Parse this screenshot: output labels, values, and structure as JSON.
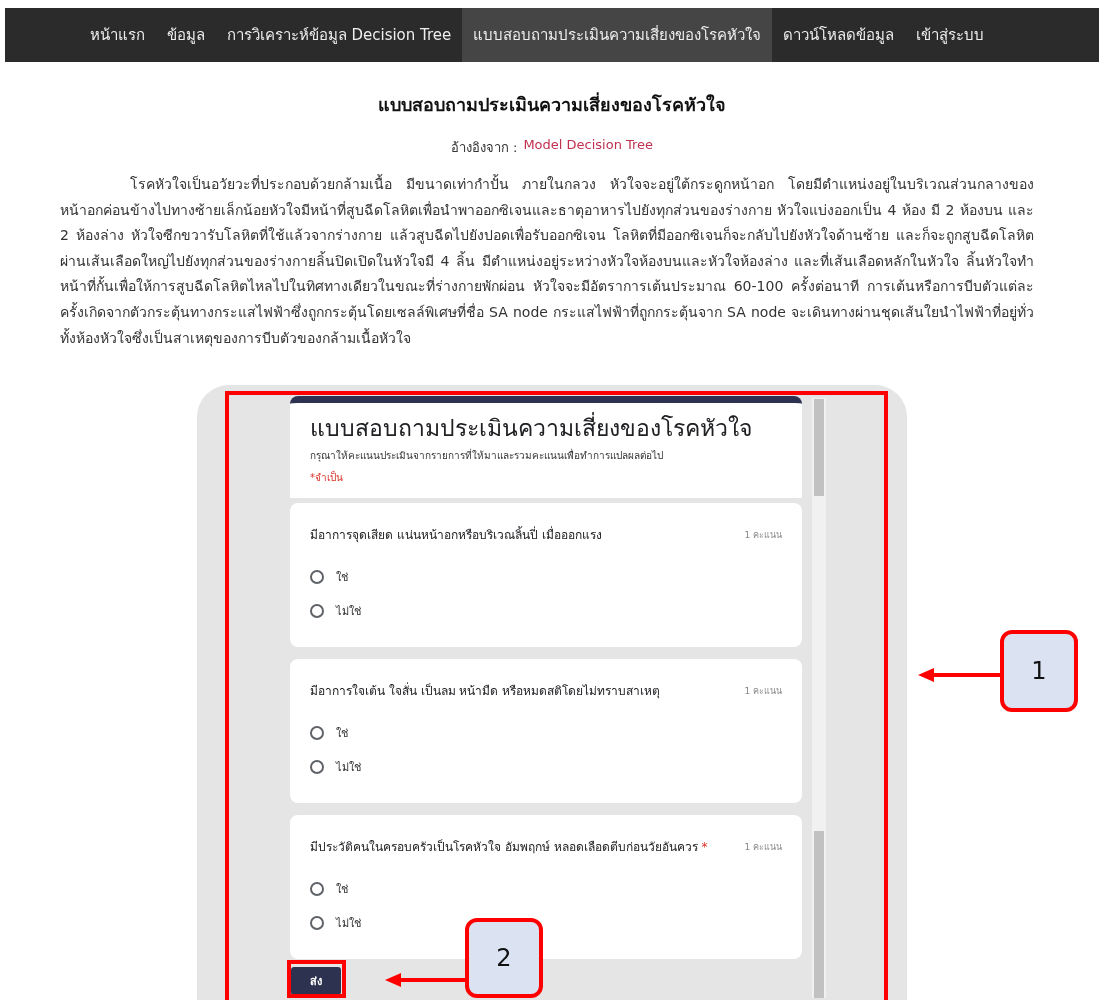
{
  "nav": {
    "items": [
      {
        "label": "หน้าแรก",
        "selected": false
      },
      {
        "label": "ข้อมูล",
        "selected": false
      },
      {
        "label": "การวิเคราะห์ข้อมูล Decision Tree",
        "selected": false
      },
      {
        "label": "แบบสอบถามประเมินความเสี่ยงของโรคหัวใจ",
        "selected": true
      },
      {
        "label": "ดาวน์โหลดข้อมูล",
        "selected": false
      },
      {
        "label": "เข้าสู่ระบบ",
        "selected": false
      }
    ]
  },
  "page": {
    "title": "แบบสอบถามประเมินความเสี่ยงของโรคหัวใจ",
    "source_label": "อ้างอิงจาก :",
    "source_link": "Model Decision Tree",
    "paragraph": "โรคหัวใจเป็นอวัยวะที่ประกอบด้วยกล้ามเนื้อ มีขนาดเท่ากำปั้น ภายในกลวง หัวใจจะอยู่ใต้กระดูกหน้าอก โดยมีตำแหน่งอยู่ในบริเวณส่วนกลางของหน้าอกค่อนข้างไปทางซ้ายเล็กน้อยหัวใจมีหน้าที่สูบฉีดโลหิตเพื่อนำพาออกซิเจนและธาตุอาหารไปยังทุกส่วนของร่างกาย หัวใจแบ่งออกเป็น 4 ห้อง มี 2 ห้องบน และ 2 ห้องล่าง หัวใจซีกขวารับโลหิตที่ใช้แล้วจากร่างกาย แล้วสูบฉีดไปยังปอดเพื่อรับออกซิเจน โลหิตที่มีออกซิเจนก็จะกลับไปยังหัวใจด้านซ้าย และก็จะถูกสูบฉีดโลหิตผ่านเส้นเลือดใหญ่ไปยังทุกส่วนของร่างกายลิ้นปิดเปิดในหัวใจมี 4 ลิ้น มีตำแหน่งอยู่ระหว่างหัวใจห้องบนและหัวใจห้องล่าง และที่เส้นเลือดหลักในหัวใจ ลิ้นหัวใจทำหน้าที่กั้นเพื่อให้การสูบฉีดโลหิตไหลไปในทิศทางเดียวในขณะที่ร่างกายพักผ่อน หัวใจจะมีอัตราการเต้นประมาณ 60-100 ครั้งต่อนาที การเต้นหรือการบีบตัวแต่ละครั้งเกิดจากตัวกระตุ้นทางกระแสไฟฟ้าซึ่งถูกกระตุ้นโดยเซลล์พิเศษที่ชื่อ SA node กระแสไฟฟ้าที่ถูกกระตุ้นจาก SA node จะเดินทางผ่านชุดเส้นใยนำไฟฟ้าที่อยู่ทั่วทั้งห้องหัวใจซึ่งเป็นสาเหตุของการบีบตัวของกล้ามเนื้อหัวใจ"
  },
  "form": {
    "title": "แบบสอบถามประเมินความเสี่ยงของโรคหัวใจ",
    "description": "กรุณาให้คะแนนประเมินจากรายการที่ให้มาและรวมคะแนนเพื่อทำการแปลผลต่อไป",
    "required_note": "*จำเป็น",
    "questions": [
      {
        "text": "มีอาการจุดเสียด แน่นหน้าอกหรือบริเวณลิ้นปี่ เมื่อออกแรง",
        "points": "1 คะแนน",
        "options": [
          {
            "label": "ใช่",
            "selected": false
          },
          {
            "label": "ไม่ใช่",
            "selected": false
          }
        ]
      },
      {
        "text": "มีอาการใจเต้น ใจสั่น เป็นลม หน้ามืด หรือหมดสติโดยไม่ทราบสาเหตุ",
        "points": "1 คะแนน",
        "options": [
          {
            "label": "ใช่",
            "selected": false
          },
          {
            "label": "ไม่ใช่",
            "selected": false
          }
        ]
      },
      {
        "text": "มีประวัติคนในครอบครัวเป็นโรคหัวใจ อัมพฤกษ์ หลอดเลือดตีบก่อนวัยอันควร",
        "required_mark": "*",
        "points": "1 คะแนน",
        "options": [
          {
            "label": "ใช่",
            "selected": false
          },
          {
            "label": "ไม่ใช่",
            "selected": false
          }
        ]
      }
    ],
    "submit": "ส่ง"
  },
  "annotations": [
    {
      "label": "1"
    },
    {
      "label": "2"
    }
  ]
}
